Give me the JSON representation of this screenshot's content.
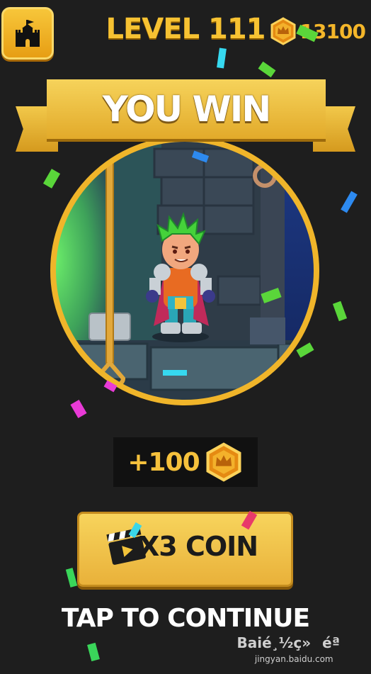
{
  "header": {
    "level_title": "LEVEL 111",
    "coin_total": "13100",
    "home_icon": "castle-icon"
  },
  "result": {
    "title": "YOU WIN",
    "scene_description_icon": "hero-scene"
  },
  "reward": {
    "amount": "+100",
    "coin_icon": "crown-coin-icon"
  },
  "actions": {
    "x3_label": "X3 COIN",
    "x3_icon": "clapperboard-icon",
    "continue_label": "TAP TO CONTINUE"
  },
  "watermark": {
    "logo_text": "Baié¸½ç»éª",
    "url": "jingyan.baidu.com"
  },
  "colors": {
    "background": "#1e1e1e",
    "gold": "#f7c232",
    "button_gold": "#f7d45c",
    "scene_ring": "#f0b52a"
  }
}
